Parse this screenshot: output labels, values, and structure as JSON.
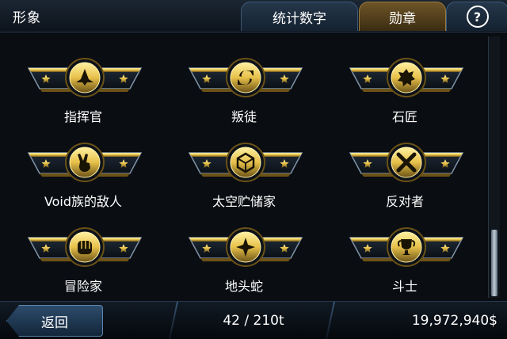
{
  "header": {
    "title": "形象",
    "tabs": [
      {
        "label": "统计数字",
        "active": false
      },
      {
        "label": "勋章",
        "active": true
      }
    ],
    "help_icon": "question-mark-icon",
    "help_glyph": "?"
  },
  "medals": [
    {
      "label": "指挥官",
      "icon": "ship-icon"
    },
    {
      "label": "叛徒",
      "icon": "cycle-arrows-icon"
    },
    {
      "label": "石匠",
      "icon": "gear-icon"
    },
    {
      "label": "Void族的敌人",
      "icon": "victory-hand-icon"
    },
    {
      "label": "太空贮储家",
      "icon": "cargo-crate-icon"
    },
    {
      "label": "反对者",
      "icon": "cross-icon"
    },
    {
      "label": "冒险家",
      "icon": "fist-icon"
    },
    {
      "label": "地头蛇",
      "icon": "compass-star-icon"
    },
    {
      "label": "斗士",
      "icon": "trophy-icon"
    }
  ],
  "footer": {
    "back_label": "返回",
    "progress": "42 / 210t",
    "money": "19,972,940$"
  },
  "colors": {
    "gold": "#e7c14a",
    "gold_dark": "#6b5216",
    "steel": "#7f93a8"
  }
}
